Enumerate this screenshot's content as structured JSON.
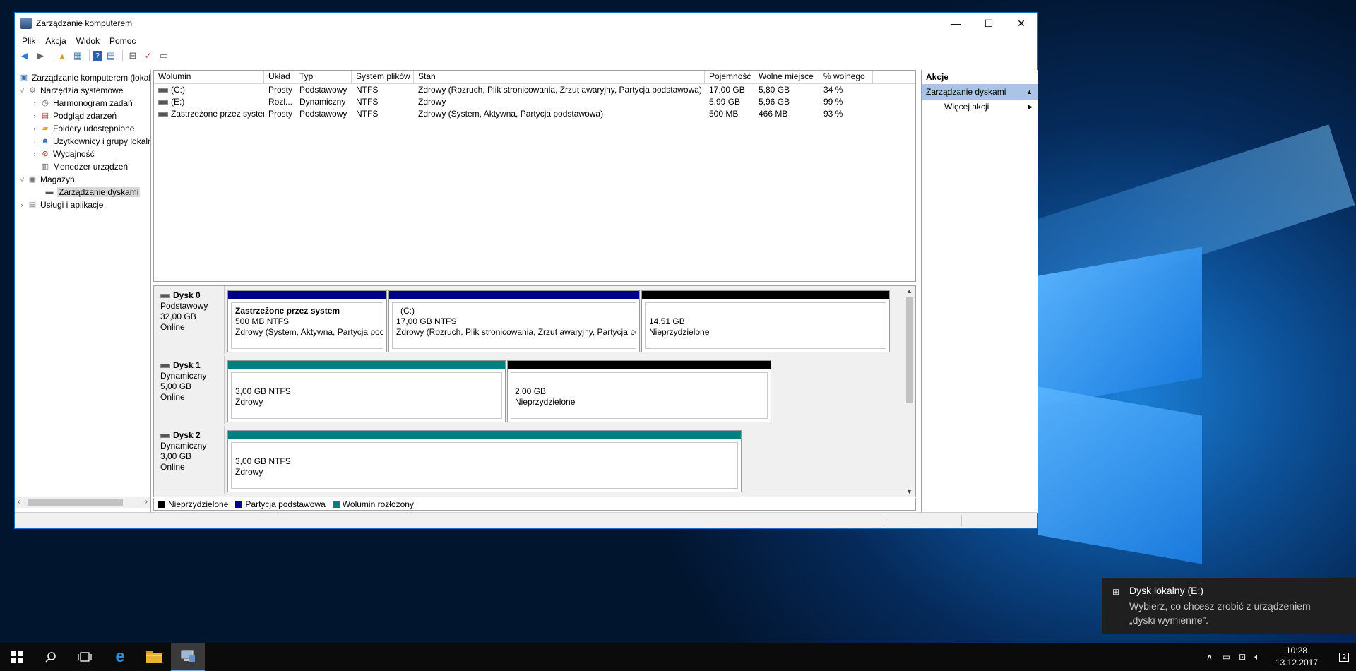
{
  "window": {
    "title": "Zarządzanie komputerem",
    "minimize": "—",
    "maximize": "☐",
    "close": "✕"
  },
  "menu": [
    "Plik",
    "Akcja",
    "Widok",
    "Pomoc"
  ],
  "tree": {
    "root": "Zarządzanie komputerem (lokalny)",
    "items": [
      {
        "label": "Narzędzia systemowe",
        "icon": "tools-icon"
      },
      {
        "label": "Harmonogram zadań",
        "icon": "clock-icon"
      },
      {
        "label": "Podgląd zdarzeń",
        "icon": "event-viewer-icon"
      },
      {
        "label": "Foldery udostępnione",
        "icon": "shared-folder-icon"
      },
      {
        "label": "Użytkownicy i grupy lokalne",
        "icon": "users-icon"
      },
      {
        "label": "Wydajność",
        "icon": "performance-icon"
      },
      {
        "label": "Menedżer urządzeń",
        "icon": "device-manager-icon"
      },
      {
        "label": "Magazyn",
        "icon": "storage-icon"
      },
      {
        "label": "Zarządzanie dyskami",
        "icon": "disk-icon"
      },
      {
        "label": "Usługi i aplikacje",
        "icon": "services-icon"
      }
    ]
  },
  "volumes": {
    "headers": [
      "Wolumin",
      "Układ",
      "Typ",
      "System plików",
      "Stan",
      "Pojemność",
      "Wolne miejsce",
      "% wolnego"
    ],
    "rows": [
      [
        "(C:)",
        "Prosty",
        "Podstawowy",
        "NTFS",
        "Zdrowy (Rozruch, Plik stronicowania, Zrzut awaryjny, Partycja podstawowa)",
        "17,00 GB",
        "5,80 GB",
        "34 %"
      ],
      [
        "(E:)",
        "Rozł...",
        "Dynamiczny",
        "NTFS",
        "Zdrowy",
        "5,99 GB",
        "5,96 GB",
        "99 %"
      ],
      [
        "Zastrzeżone przez system",
        "Prosty",
        "Podstawowy",
        "NTFS",
        "Zdrowy (System, Aktywna, Partycja podstawowa)",
        "500 MB",
        "466 MB",
        "93 %"
      ]
    ]
  },
  "disks": [
    {
      "name": "Dysk 0",
      "type": "Podstawowy",
      "size": "32,00 GB",
      "status": "Online",
      "partitions": [
        {
          "name": "Zastrzeżone przez system",
          "size": "500 MB NTFS",
          "state": "Zdrowy (System, Aktywna, Partycja podstawowa)"
        },
        {
          "name": "(C:)",
          "size": "17,00 GB NTFS",
          "state": "Zdrowy (Rozruch, Plik stronicowania, Zrzut awaryjny, Partycja podstawowa)"
        },
        {
          "name": "",
          "size": "14,51 GB",
          "state": "Nieprzydzielone"
        }
      ]
    },
    {
      "name": "Dysk 1",
      "type": "Dynamiczny",
      "size": "5,00 GB",
      "status": "Online",
      "partitions": [
        {
          "name": "",
          "size": "3,00 GB NTFS",
          "state": "Zdrowy"
        },
        {
          "name": "",
          "size": "2,00 GB",
          "state": "Nieprzydzielone"
        }
      ]
    },
    {
      "name": "Dysk 2",
      "type": "Dynamiczny",
      "size": "3,00 GB",
      "status": "Online",
      "partitions": [
        {
          "name": "",
          "size": "3,00 GB NTFS",
          "state": "Zdrowy"
        }
      ]
    }
  ],
  "legend": [
    {
      "label": "Nieprzydzielone",
      "color": "#000000"
    },
    {
      "label": "Partycja podstawowa",
      "color": "#00008b"
    },
    {
      "label": "Wolumin rozłożony",
      "color": "#008080"
    }
  ],
  "actions": {
    "title": "Akcje",
    "section": "Zarządzanie dyskami",
    "more": "Więcej akcji"
  },
  "toast": {
    "title": "Dysk lokalny (E:)",
    "body_line1": "Wybierz, co chcesz zrobić z urządzeniem",
    "body_line2": "„dyski wymienne”."
  },
  "taskbar": {
    "time": "10:28",
    "date": "13.12.2017",
    "notifications": "2"
  },
  "colors": {
    "unallocated": "#000000",
    "primary": "#00008b",
    "striped": "#008080",
    "selection": "#a9c4e4"
  }
}
